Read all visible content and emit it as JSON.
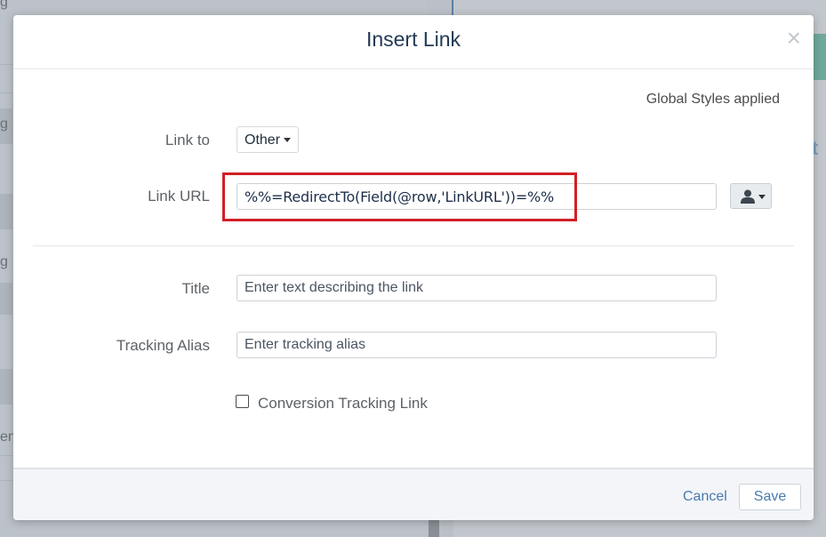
{
  "backdrop": {
    "fragments": [
      "g",
      "g",
      "g",
      "ent"
    ],
    "right_fragment": "t"
  },
  "dialog": {
    "title": "Insert Link",
    "close_glyph": "×",
    "global_styles_text": "Global Styles applied",
    "link_to": {
      "label": "Link to",
      "selected": "Other"
    },
    "link_url": {
      "label": "Link URL",
      "value": "%%=RedirectTo(Field(@row,'LinkURL'))=%%",
      "personalize_icon": "user-icon"
    },
    "title_field": {
      "label": "Title",
      "placeholder": "Enter text describing the link",
      "value": ""
    },
    "tracking_alias": {
      "label": "Tracking Alias",
      "placeholder": "Enter tracking alias",
      "value": ""
    },
    "conversion_tracking": {
      "label": "Conversion Tracking Link",
      "checked": false
    },
    "footer": {
      "cancel_label": "Cancel",
      "save_label": "Save"
    }
  },
  "colors": {
    "highlight": "#d21f26",
    "link_blue": "#4a7bb0",
    "title_navy": "#233a54"
  }
}
